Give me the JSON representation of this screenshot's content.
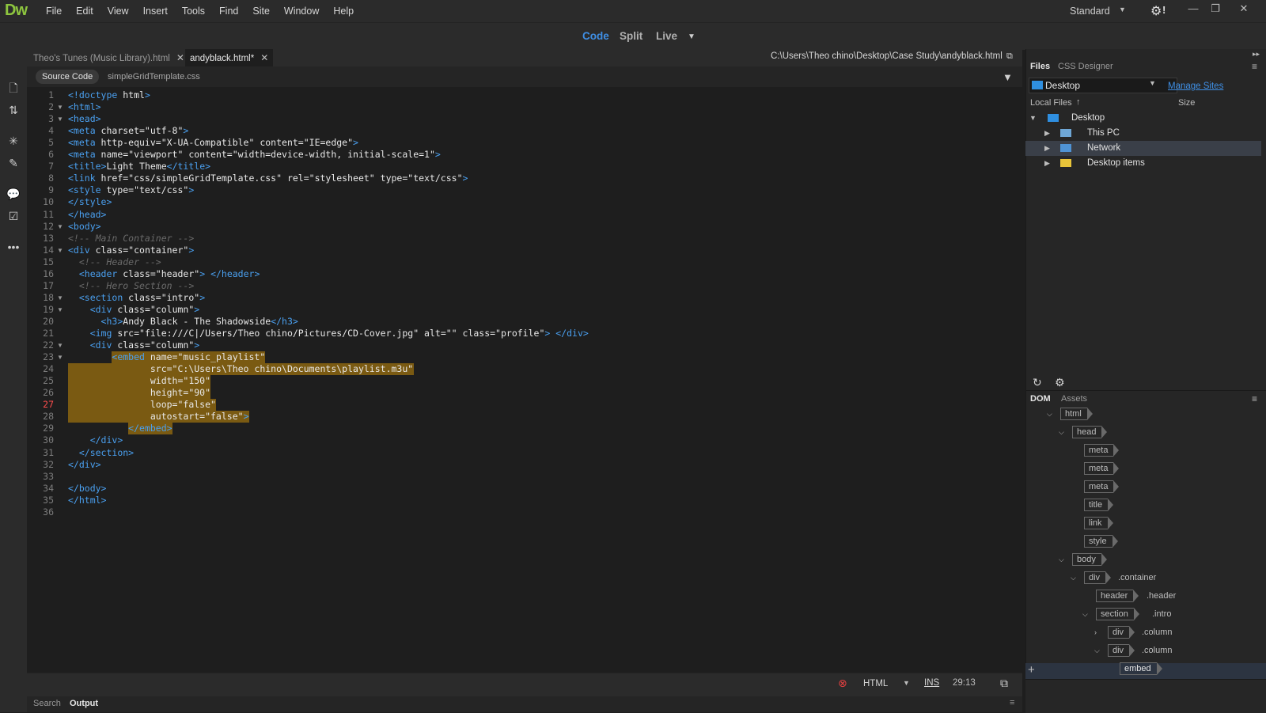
{
  "app": {
    "logo": "Dw",
    "menus": [
      "File",
      "Edit",
      "View",
      "Insert",
      "Tools",
      "Find",
      "Site",
      "Window",
      "Help"
    ],
    "workspace": "Standard",
    "settings_mark": "!"
  },
  "viewbar": {
    "code": "Code",
    "split": "Split",
    "live": "Live"
  },
  "tabs": [
    {
      "label": "Theo's Tunes (Music Library).html"
    },
    {
      "label": "andyblack.html*"
    }
  ],
  "doc_path": "C:\\Users\\Theo chino\\Desktop\\Case Study\\andyblack.html",
  "related": {
    "source": "Source Code",
    "css": "simpleGridTemplate.css"
  },
  "code_lines": [
    "<!doctype html>",
    "<html>",
    "<head>",
    "<meta charset=\"utf-8\">",
    "<meta http-equiv=\"X-UA-Compatible\" content=\"IE=edge\">",
    "<meta name=\"viewport\" content=\"width=device-width, initial-scale=1\">",
    "<title>Light Theme</title>",
    "<link href=\"css/simpleGridTemplate.css\" rel=\"stylesheet\" type=\"text/css\">",
    "<style type=\"text/css\">",
    "</style>",
    "</head>",
    "<body>",
    "<!-- Main Container -->",
    "<div class=\"container\">",
    "  <!-- Header -->",
    "  <header class=\"header\"> </header>",
    "  <!-- Hero Section -->",
    "  <section class=\"intro\">",
    "    <div class=\"column\">",
    "      <h3>Andy Black - The Shadowside</h3>",
    "    <img src=\"file:///C|/Users/Theo chino/Pictures/CD-Cover.jpg\" alt=\"\" class=\"profile\"> </div>",
    "    <div class=\"column\">",
    "        <embed name=\"music_playlist\"",
    "               src=\"C:\\Users\\Theo chino\\Documents\\playlist.m3u\"",
    "               width=\"150\"",
    "               height=\"90\"",
    "               loop=\"false\"",
    "               autostart=\"false\">",
    "           </embed>",
    "    </div>",
    "  </section>",
    "</div>",
    "",
    "</body>",
    "</html>",
    ""
  ],
  "status": {
    "language": "HTML",
    "mode": "INS",
    "cursor": "29:13"
  },
  "bottom_tabs": [
    "Search",
    "Output"
  ],
  "right_panel": {
    "tabs": [
      "Files",
      "CSS Designer"
    ],
    "site": "Desktop",
    "manage_sites": "Manage Sites",
    "local_files": "Local Files",
    "size": "Size",
    "tree": [
      {
        "label": "Desktop"
      },
      {
        "label": "This PC"
      },
      {
        "label": "Network"
      },
      {
        "label": "Desktop items"
      }
    ],
    "dom_tabs": [
      "DOM",
      "Assets"
    ],
    "dom": [
      {
        "tag": "html",
        "cls": ""
      },
      {
        "tag": "head",
        "cls": ""
      },
      {
        "tag": "meta",
        "cls": ""
      },
      {
        "tag": "meta",
        "cls": ""
      },
      {
        "tag": "meta",
        "cls": ""
      },
      {
        "tag": "title",
        "cls": ""
      },
      {
        "tag": "link",
        "cls": ""
      },
      {
        "tag": "style",
        "cls": ""
      },
      {
        "tag": "body",
        "cls": ""
      },
      {
        "tag": "div",
        "cls": ".container"
      },
      {
        "tag": "header",
        "cls": ".header"
      },
      {
        "tag": "section",
        "cls": ".intro"
      },
      {
        "tag": "div",
        "cls": ".column"
      },
      {
        "tag": "div",
        "cls": ".column"
      },
      {
        "tag": "embed",
        "cls": ""
      }
    ]
  },
  "colors": {
    "accent": "#3f8fe5",
    "highlight": "#7a5a12",
    "logo": "#8ec63f"
  }
}
